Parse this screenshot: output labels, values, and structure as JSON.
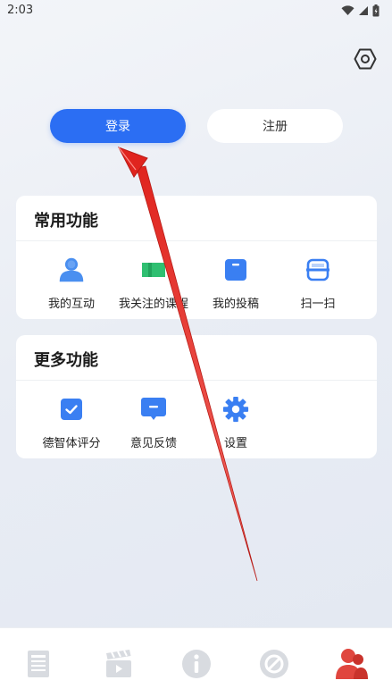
{
  "status": {
    "time": "2:03",
    "icons": [
      "wifi-icon",
      "signal-icon",
      "battery-icon"
    ]
  },
  "header": {
    "settings_icon": "hexagon-settings-icon"
  },
  "auth": {
    "login_label": "登录",
    "register_label": "注册"
  },
  "common_section": {
    "title": "常用功能",
    "items": [
      {
        "label": "我的互动",
        "icon": "person-icon"
      },
      {
        "label": "我关注的课程",
        "icon": "bookmark-icon"
      },
      {
        "label": "我的投稿",
        "icon": "submission-icon"
      },
      {
        "label": "扫一扫",
        "icon": "scan-icon"
      }
    ]
  },
  "more_section": {
    "title": "更多功能",
    "items": [
      {
        "label": "德智体评分",
        "icon": "checkbox-icon"
      },
      {
        "label": "意见反馈",
        "icon": "message-icon"
      },
      {
        "label": "设置",
        "icon": "gear-icon"
      }
    ]
  },
  "tabbar": {
    "tabs": [
      {
        "icon": "news-icon",
        "active": false
      },
      {
        "icon": "clapperboard-icon",
        "active": false
      },
      {
        "icon": "info-icon",
        "active": false
      },
      {
        "icon": "forbidden-icon",
        "active": false
      },
      {
        "icon": "user-group-icon",
        "active": true
      }
    ]
  },
  "colors": {
    "primary": "#2b6ef3",
    "active_tab": "#e0463e",
    "inactive_tab": "#d8dbe0",
    "annotation_arrow": "#e0241e"
  }
}
